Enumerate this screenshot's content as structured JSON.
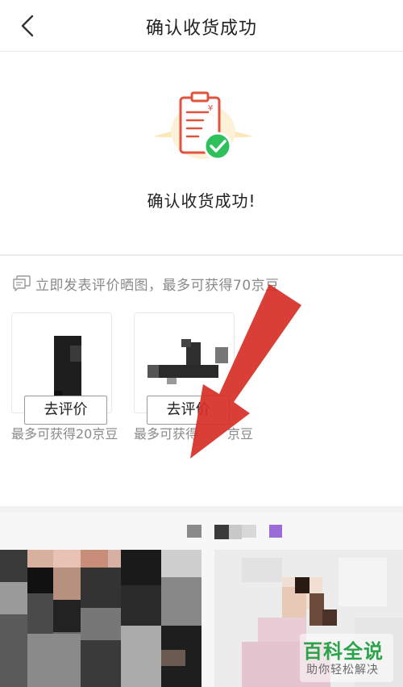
{
  "header": {
    "back_icon": "chevron-left-icon",
    "title": "确认收货成功"
  },
  "success": {
    "icon": "clipboard-check-icon",
    "message": "确认收货成功!"
  },
  "review": {
    "tip_icon": "comment-icon",
    "tip": "立即发表评价晒图，最多可获得70京豆",
    "products": [
      {
        "reward": "最多可获得20京豆",
        "button_label": "去评价"
      },
      {
        "reward": "最多可获得",
        "reward_tail": "京豆",
        "button_label": "去评价"
      }
    ]
  },
  "watermark": {
    "title": "百科全说",
    "subtitle": "助你轻松解决"
  },
  "colors": {
    "accent_red": "#d83a2e",
    "check_green": "#2ec05a",
    "watermark_green": "#2aa34a"
  }
}
